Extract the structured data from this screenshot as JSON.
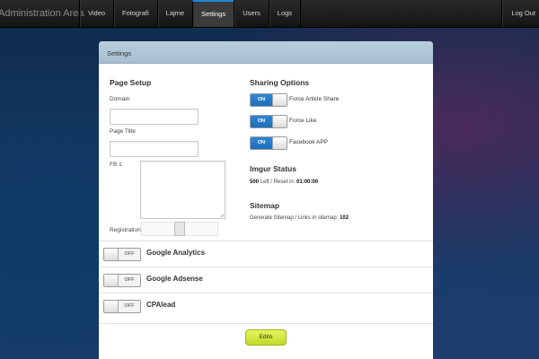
{
  "topbar": {
    "brand": "Administration Area",
    "nav": [
      "Video",
      "Fotografi",
      "Lajme",
      "Settings",
      "Users",
      "Logs"
    ],
    "active": "Settings",
    "logout": "Log Out"
  },
  "panel": {
    "title": "Settings",
    "page_setup": {
      "title": "Page Setup",
      "domain_label": "Domain",
      "domain_value": "",
      "page_title_label": "Page Title",
      "page_title_value": "",
      "fb_label": "FB 1",
      "fb_value": "",
      "registration_label": "Registration"
    },
    "sharing": {
      "title": "Sharing Options",
      "options": [
        {
          "state": "ON",
          "label": "Force Article Share"
        },
        {
          "state": "ON",
          "label": "Force Like"
        },
        {
          "state": "ON",
          "label": "Facebook APP"
        }
      ]
    },
    "imgur": {
      "title": "Imgur Status",
      "left_value": "500",
      "left_text": "Left / Reset in:",
      "reset_value": "01:00:00"
    },
    "sitemap": {
      "title": "Sitemap",
      "generate_link": "Generate Sitemap",
      "links_text": "/ Links in sitemap:",
      "links_value": "102"
    },
    "integrations": [
      {
        "state": "OFF",
        "title": "Google Analytics"
      },
      {
        "state": "OFF",
        "title": "Google Adsense"
      },
      {
        "state": "OFF",
        "title": "CPAlead"
      }
    ],
    "edit_button": "Edito"
  },
  "colors": {
    "accent": "#1f86d6",
    "toggle_on": "#2d86d6",
    "edit_button": "#d4e842",
    "panel_header": "#b0c8da"
  }
}
